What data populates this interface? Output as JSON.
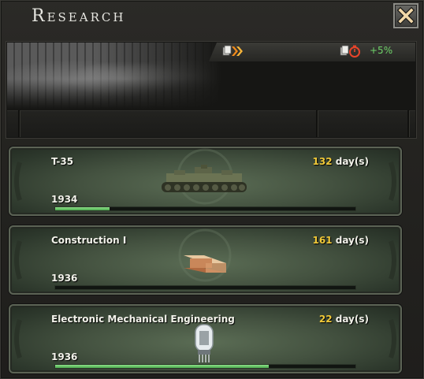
{
  "window": {
    "title": "Research"
  },
  "close": {
    "icon": "close-x-icon"
  },
  "header": {
    "bonus_left_icon": "research-speed-arrows-icon",
    "bonus_right_icon": "research-timer-icon",
    "bonus_value": "+5%",
    "bonus_color": "#6fd36a"
  },
  "slots": [
    {
      "name": "T-35",
      "days": "132",
      "days_suffix": " day(s)",
      "year": "1934",
      "progress": 0.18,
      "icon": "tank-icon"
    },
    {
      "name": "Construction I",
      "days": "161",
      "days_suffix": " day(s)",
      "year": "1936",
      "progress": 0.0,
      "icon": "steel-beam-icon"
    },
    {
      "name": "Electronic Mechanical Engineering",
      "days": "22",
      "days_suffix": " day(s)",
      "year": "1936",
      "progress": 0.71,
      "icon": "vacuum-tube-icon"
    }
  ],
  "colors": {
    "days_number": "#f0c838",
    "progress": "#6cc96a"
  }
}
